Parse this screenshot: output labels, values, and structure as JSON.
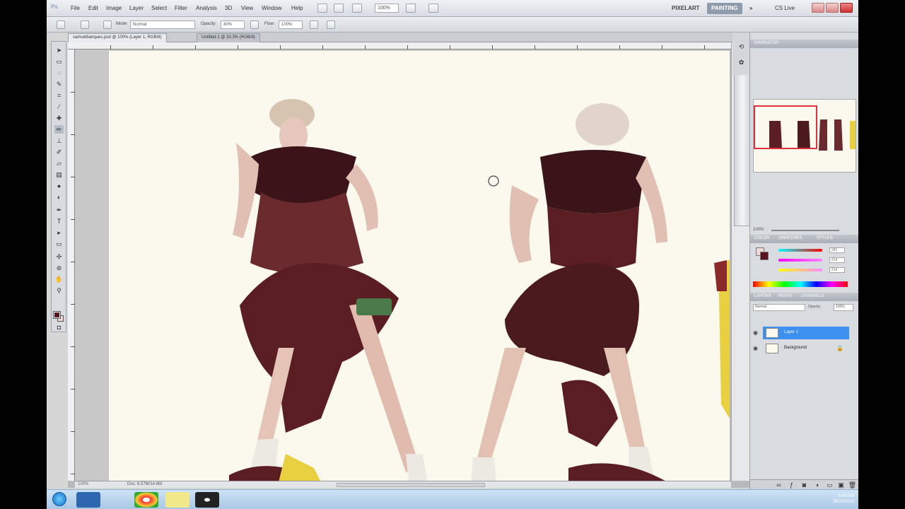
{
  "app": {
    "logo": "Ps",
    "menu": [
      "File",
      "Edit",
      "Image",
      "Layer",
      "Select",
      "Filter",
      "Analysis",
      "3D",
      "View",
      "Window",
      "Help"
    ],
    "zoom": "100%",
    "workspaces": [
      "PIXELART",
      "PAINTING"
    ],
    "active_workspace": "PAINTING",
    "cs_live": "CS Live"
  },
  "options": {
    "mode_label": "Mode:",
    "mode_value": "Normal",
    "opacity_label": "Opacity:",
    "opacity_value": "40%",
    "flow_label": "Flow:",
    "flow_value": "100%"
  },
  "tabs": [
    {
      "label": "samuelbanques.psd @ 100% (Layer 1, RGB/8)",
      "active": true
    },
    {
      "label": "Untitled-1 @ 33.3% (RGB/8)",
      "active": false
    }
  ],
  "status": {
    "zoom": "100%",
    "doc": "Doc: 6.57M/14.6M"
  },
  "panels": {
    "navigator_tabs": [
      "NAVIGATOR"
    ],
    "navigator_zoom": "100%",
    "color_tabs": [
      "COLOR",
      "SWATCHES",
      "STYLES"
    ],
    "color_values": [
      "241",
      "214",
      "214"
    ],
    "layers_tabs": [
      "LAYERS",
      "PATHS",
      "CHANNELS"
    ],
    "layer_mode": "Normal",
    "layer_opacity_label": "Opacity:",
    "layer_opacity": "100%",
    "layers": [
      {
        "name": "Layer 1",
        "selected": true
      },
      {
        "name": "Background",
        "selected": false
      }
    ]
  },
  "taskbar": {
    "apps": [
      "Windows Explorer",
      "Photoshop",
      "Chrome",
      "Sticky Notes",
      "OBS"
    ],
    "time": "5:49 PM",
    "date": "28/10/2013"
  },
  "colors": {
    "fg": "#5a1420",
    "bg": "#f1d6d6",
    "selected_layer": "#3d8ff0",
    "accent_frame": "#e03040"
  }
}
